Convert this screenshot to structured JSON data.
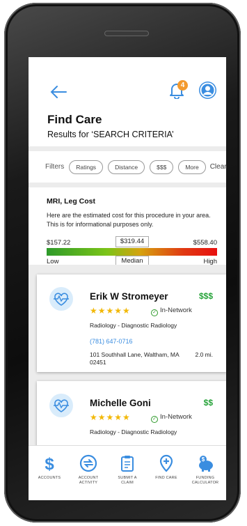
{
  "header": {
    "back_icon": "arrow-left-icon",
    "notification_count": "4",
    "title": "Find Care",
    "subtitle": "Results for ‘SEARCH CRITERIA’"
  },
  "filters": {
    "label": "Filters",
    "chips": [
      "Ratings",
      "Distance",
      "$$$",
      "More"
    ],
    "clear": "Clear"
  },
  "cost": {
    "procedure": "MRI, Leg Cost",
    "description": "Here are the estimated cost for this procedure in your area. This is for informational purposes only.",
    "low_value": "$157.22",
    "median_value": "$319.44",
    "high_value": "$558.40",
    "low_label": "Low",
    "median_label": "Median",
    "high_label": "High"
  },
  "providers": [
    {
      "name": "Erik W Stromeyer",
      "price": "$$$",
      "rating": 4.5,
      "stars": "★★★★★",
      "network": "In-Network",
      "specialty": "Radiology - Diagnostic Radiology",
      "phone": "(781) 647-0716",
      "address": "101 Southhall Lane, Waltham, MA 02451",
      "distance": "2.0 mi."
    },
    {
      "name": "Michelle Goni",
      "price": "$$",
      "rating": 4.5,
      "stars": "★★★★★",
      "network": "In-Network",
      "specialty": "Radiology - Diagnostic Radiology"
    }
  ],
  "nav": [
    {
      "label": "ACCOUNTS",
      "icon": "dollar-icon"
    },
    {
      "label": "ACCOUNT\nACTIVITY",
      "icon": "activity-icon"
    },
    {
      "label": "SUBMIT A\nCLAIM",
      "icon": "clipboard-icon"
    },
    {
      "label": "FIND CARE",
      "icon": "location-pin-icon"
    },
    {
      "label": "FUNDING\nCALCULATOR",
      "icon": "piggy-bank-icon"
    }
  ],
  "colors": {
    "accent": "#3a8de0",
    "price": "#27a33a",
    "star": "#f2b807",
    "badge": "#f39a2e"
  }
}
